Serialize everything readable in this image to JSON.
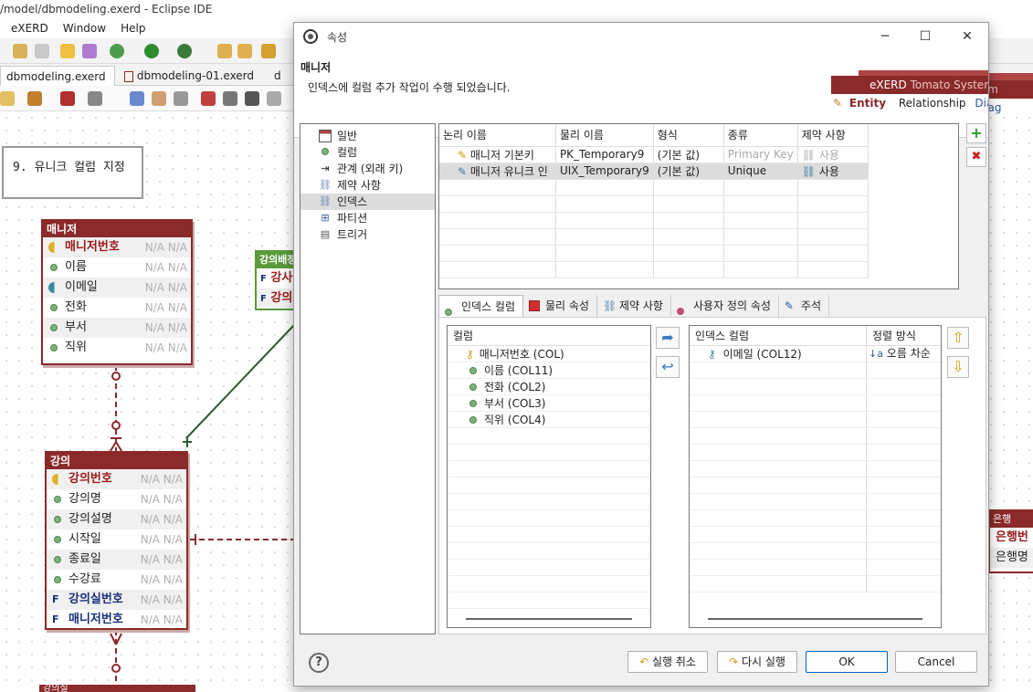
{
  "ide": {
    "title": "/model/dbmodeling.exerd - Eclipse IDE",
    "menu": [
      "eXERD",
      "Window",
      "Help"
    ],
    "tabs": [
      "dbmodeling.exerd",
      "dbmodeling-01.exerd",
      "d"
    ]
  },
  "diagram": {
    "note": "9. 유니크 컬럼 지정",
    "na": "N/A N/A",
    "manager_entity": {
      "title": "매니저",
      "rows": [
        "매니저번호",
        "이름",
        "이메일",
        "전화",
        "부서",
        "직위"
      ]
    },
    "lecture_entity": {
      "title": "강의",
      "rows": [
        "강의번호",
        "강의명",
        "강의설명",
        "시작일",
        "종료일",
        "수강료",
        "강의실번호",
        "매니저번호"
      ]
    },
    "green_entity": {
      "title": "강의배정",
      "rows": [
        "강사",
        "강의"
      ]
    },
    "right_entity": {
      "title": "은행",
      "rows": [
        "은행번",
        "은행명"
      ]
    },
    "bottom_entity_title": "강의실",
    "editor_tabs": {
      "brand": "eXERD",
      "theme": "Tomato System",
      "entity": "Entity",
      "relationship": "Relationship",
      "diagram": "Diag"
    }
  },
  "dialog": {
    "title": "속성",
    "heading": "매니저",
    "message": "인덱스에 컬럼 추가 작업이 수행 되었습니다.",
    "tree": [
      "일반",
      "컬럼",
      "관계 (외래 키)",
      "제약 사항",
      "인덱스",
      "파티션",
      "트리거"
    ],
    "grid": {
      "headers": [
        "논리 이름",
        "물리 이름",
        "형식",
        "종류",
        "제약 사항"
      ],
      "rows": [
        {
          "logical": "매니저 기본키",
          "physical": "PK_Temporary9",
          "format": "(기본 값)",
          "kind": "Primary Key",
          "constraint": "사용"
        },
        {
          "logical": "매니저 유니크 인",
          "physical": "UIX_Temporary9",
          "format": "(기본 값)",
          "kind": "Unique",
          "constraint": "사용"
        }
      ]
    },
    "side_buttons": {
      "add": "+",
      "remove": "✖"
    },
    "tabs": [
      "인덱스 컬럼",
      "물리 속성",
      "제약 사항",
      "사용자 정의 속성",
      "주석"
    ],
    "columns_list": {
      "header": "컬럼",
      "items": [
        "매니저번호 (COL)",
        "이름 (COL11)",
        "전화 (COL2)",
        "부서 (COL3)",
        "직위 (COL4)"
      ]
    },
    "index_columns": {
      "header_col": "인덱스 컬럼",
      "header_sort": "정렬 방식",
      "rows": [
        {
          "name": "이메일 (COL12)",
          "sort": "오름 차순"
        }
      ]
    },
    "footer": {
      "help": "?",
      "undo": "실행 취소",
      "redo": "다시 실행",
      "ok": "OK",
      "cancel": "Cancel"
    }
  }
}
